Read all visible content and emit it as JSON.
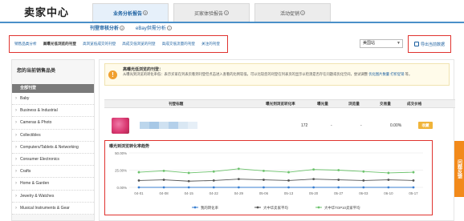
{
  "header": {
    "title": "卖家中心"
  },
  "main_tabs": [
    {
      "label": "业务分析报告",
      "active": true
    },
    {
      "label": "买家体验报告",
      "active": false
    },
    {
      "label": "活动促销",
      "active": false
    }
  ],
  "sub_links": [
    {
      "label": "刊登审核分析",
      "active": true
    },
    {
      "label": "eBay供需分析",
      "active": false
    }
  ],
  "report_tabs": [
    {
      "label": "销售品类分析",
      "active": false
    },
    {
      "label": "高曝光低浏览的刊登",
      "active": true
    },
    {
      "label": "高浏览低成交的刊登",
      "active": false
    },
    {
      "label": "高成交低浏览的刊登",
      "active": false
    },
    {
      "label": "高成交低流量的刊登",
      "active": false
    },
    {
      "label": "关注的刊登",
      "active": false
    }
  ],
  "filters": {
    "region_value": "美国站",
    "export_label": "导出当前数据"
  },
  "sidebar": {
    "title": "您的当前销售品类",
    "all_label": "全部刊登",
    "categories": [
      "Baby",
      "Business & Industrial",
      "Cameras & Photo",
      "Collectibles",
      "Computers/Tablets & Networking",
      "Consumer Electronics",
      "Crafts",
      "Home & Garden",
      "Jewelry & Watches",
      "Musical Instruments & Gear"
    ]
  },
  "tip": {
    "title": "高曝光低浏览的刊登：",
    "text": "从曝光到浏览的转化率低：表示买家在列表页看到刊登但点击进入查看的比例较低，可以比较您的刊登在列表页的显示以检测是否存在问题或优化空间，尝试调整",
    "link1": "优化图片数量",
    "link2": "打折促销",
    "text2": "等。"
  },
  "table": {
    "headers": [
      "刊登标题",
      "曝光到浏览转化率",
      "曝光量",
      "浏览量",
      "交易量",
      "成交价格"
    ],
    "row": {
      "conversion": "",
      "impressions": "172",
      "views": "-",
      "transactions": "-",
      "price": "0.00%",
      "button": "收藏"
    }
  },
  "chart_data": {
    "type": "line",
    "title": "曝光到浏览转化率趋势",
    "x": [
      "04-01",
      "04-08",
      "04-15",
      "04-22",
      "04-29",
      "05-06",
      "05-13",
      "05-20",
      "05-27",
      "06-03",
      "06-10",
      "05-17"
    ],
    "ylim": [
      0,
      50
    ],
    "y_ticks": [
      "50.00%",
      "25.00%",
      "0.00%"
    ],
    "grid": true,
    "legend_position": "bottom",
    "series": [
      {
        "name": "我的转化率",
        "color": "#3a7fd0",
        "values": [
          0,
          0,
          0,
          0,
          0,
          0,
          0,
          0,
          0,
          0,
          0,
          0
        ]
      },
      {
        "name": "大中华卖家平均",
        "color": "#555555",
        "values": [
          10,
          11,
          9,
          10,
          12,
          11,
          10,
          12,
          11,
          10,
          11,
          10
        ]
      },
      {
        "name": "大中华TOP10卖家平均",
        "color": "#6cc26c",
        "values": [
          22,
          24,
          21,
          23,
          27,
          24,
          22,
          26,
          25,
          23,
          21,
          22
        ]
      }
    ]
  },
  "side_tab": {
    "label": "问题反馈"
  },
  "colors": {
    "accent": "#1a5fa0",
    "highlight": "#e0332f",
    "warning": "#f0a030",
    "feedback": "#f28a1b"
  }
}
